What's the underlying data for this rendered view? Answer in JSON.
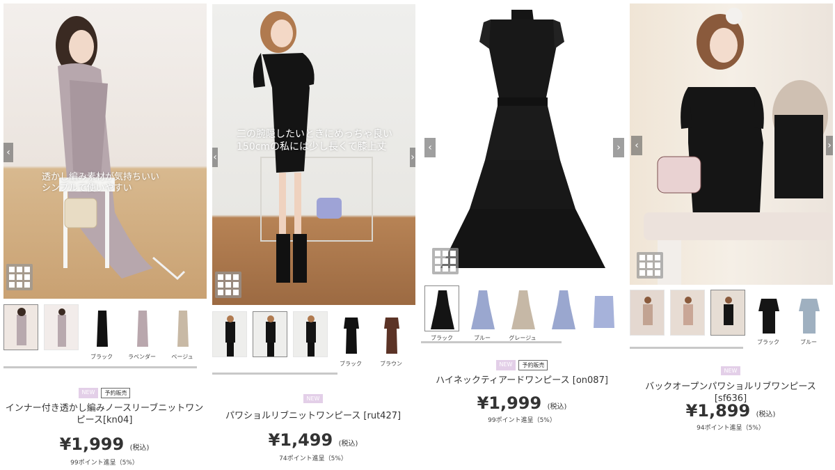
{
  "colors": {
    "tag_new_bg": "#e3cfe8",
    "price": "#333333",
    "scrollbar": "#c8c8c8"
  },
  "icons": {
    "prev": "chevron-left-icon",
    "next": "chevron-right-icon",
    "grid": "grid-view-icon"
  },
  "products": [
    {
      "overlay": "透かし編み素材が気持ちいい\nシンプルで使いやすい",
      "thumb_labels": [
        "",
        "",
        "ブラック",
        "ラベンダー",
        "ベージュ"
      ],
      "tag_new": "NEW",
      "tag_pre": "予約販売",
      "title": "インナー付き透かし編みノースリーブニットワンピース[kn04]",
      "price": "¥1,999",
      "tax": "(税込)",
      "points": "99ポイント進呈（5%）"
    },
    {
      "overlay": "二の腕隠したいときにめっちゃ良い\n150cmの私には少し長くて膝上丈",
      "thumb_labels": [
        "",
        "",
        "",
        "ブラック",
        "ブラウン"
      ],
      "tag_new": "NEW",
      "title": "パワショルリブニットワンピース [rut427]",
      "price": "¥1,499",
      "tax": "(税込)",
      "points": "74ポイント進呈（5%）"
    },
    {
      "thumb_labels": [
        "ブラック",
        "ブルー",
        "グレージュ",
        "",
        ""
      ],
      "tag_new": "NEW",
      "tag_pre": "予約販売",
      "title": "ハイネックティアードワンピース [on087]",
      "price": "¥1,999",
      "tax": "(税込)",
      "points": "99ポイント進呈（5%）"
    },
    {
      "thumb_labels": [
        "",
        "",
        "",
        "ブラック",
        "ブルー"
      ],
      "tag_new": "NEW",
      "title": "バックオープンパワショルリブワンピース [sf636]",
      "price": "¥1,899",
      "tax": "(税込)",
      "points": "94ポイント進呈（5%）"
    }
  ]
}
